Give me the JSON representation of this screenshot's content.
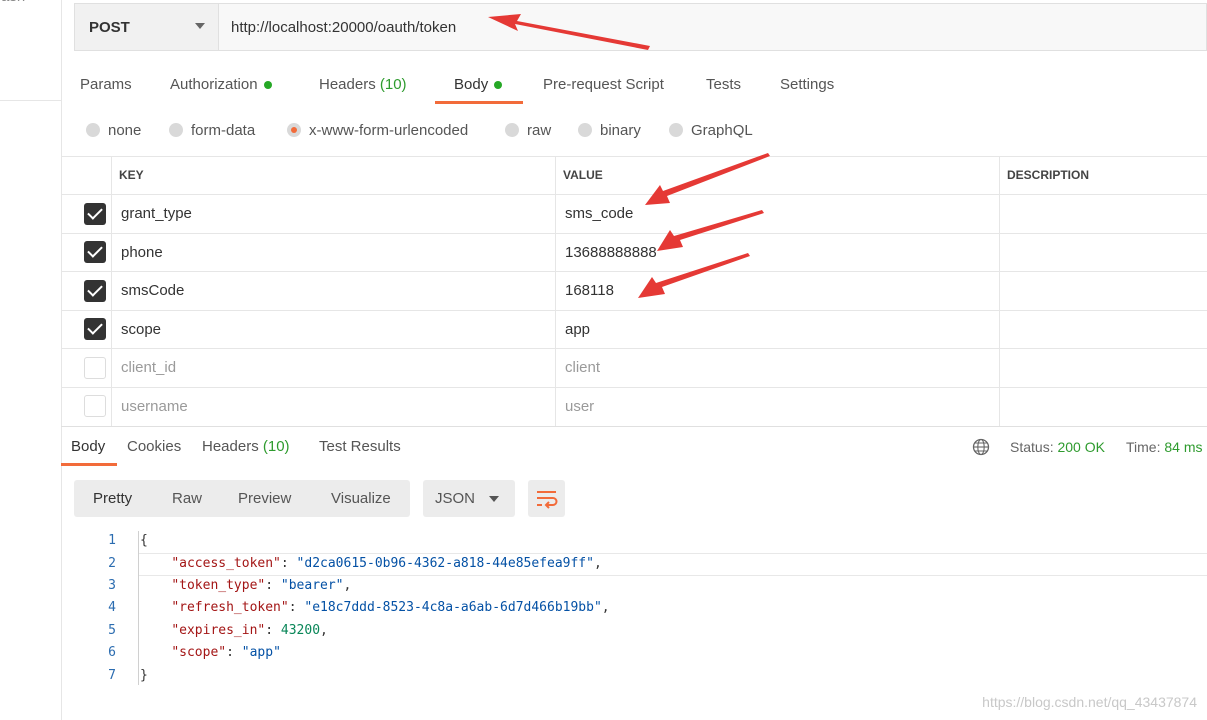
{
  "sidebar": {
    "trash_label": "rash"
  },
  "request": {
    "method": "POST",
    "url": "http://localhost:20000/oauth/token",
    "tabs": [
      {
        "label": "Params"
      },
      {
        "label": "Authorization"
      },
      {
        "label": "Headers",
        "count": "(10)"
      },
      {
        "label": "Body"
      },
      {
        "label": "Pre-request Script"
      },
      {
        "label": "Tests"
      },
      {
        "label": "Settings"
      }
    ],
    "active_tab": "Body",
    "body_types": [
      "none",
      "form-data",
      "x-www-form-urlencoded",
      "raw",
      "binary",
      "GraphQL"
    ],
    "selected_body_type": "x-www-form-urlencoded"
  },
  "params_table": {
    "headers": {
      "key": "KEY",
      "value": "VALUE",
      "description": "DESCRIPTION"
    },
    "rows": [
      {
        "checked": true,
        "key": "grant_type",
        "value": "sms_code"
      },
      {
        "checked": true,
        "key": "phone",
        "value": "13688888888"
      },
      {
        "checked": true,
        "key": "smsCode",
        "value": "168118"
      },
      {
        "checked": true,
        "key": "scope",
        "value": "app"
      },
      {
        "checked": false,
        "key": "client_id",
        "value": "client"
      },
      {
        "checked": false,
        "key": "username",
        "value": "user"
      }
    ]
  },
  "response": {
    "tabs": [
      {
        "label": "Body"
      },
      {
        "label": "Cookies"
      },
      {
        "label": "Headers",
        "count": "(10)"
      },
      {
        "label": "Test Results"
      }
    ],
    "status_label": "Status:",
    "status_value": "200 OK",
    "time_label": "Time:",
    "time_value": "84 ms",
    "view_modes": [
      "Pretty",
      "Raw",
      "Preview",
      "Visualize"
    ],
    "active_view": "Pretty",
    "format": "JSON",
    "line_numbers": [
      "1",
      "2",
      "3",
      "4",
      "5",
      "6",
      "7"
    ],
    "json_body": {
      "open": "{",
      "close": "}",
      "fields": [
        {
          "key": "\"access_token\"",
          "value": "\"d2ca0615-0b96-4362-a818-44e85efea9ff\"",
          "type": "string",
          "comma": ","
        },
        {
          "key": "\"token_type\"",
          "value": "\"bearer\"",
          "type": "string",
          "comma": ","
        },
        {
          "key": "\"refresh_token\"",
          "value": "\"e18c7ddd-8523-4c8a-a6ab-6d7d466b19bb\"",
          "type": "string",
          "comma": ","
        },
        {
          "key": "\"expires_in\"",
          "value": "43200",
          "type": "number",
          "comma": ","
        },
        {
          "key": "\"scope\"",
          "value": "\"app\"",
          "type": "string",
          "comma": ""
        }
      ]
    }
  },
  "watermark": "https://blog.csdn.net/qq_43437874",
  "colors": {
    "accent": "#f26b3a",
    "success": "#2e9b2e",
    "arrow": "#e53935"
  }
}
